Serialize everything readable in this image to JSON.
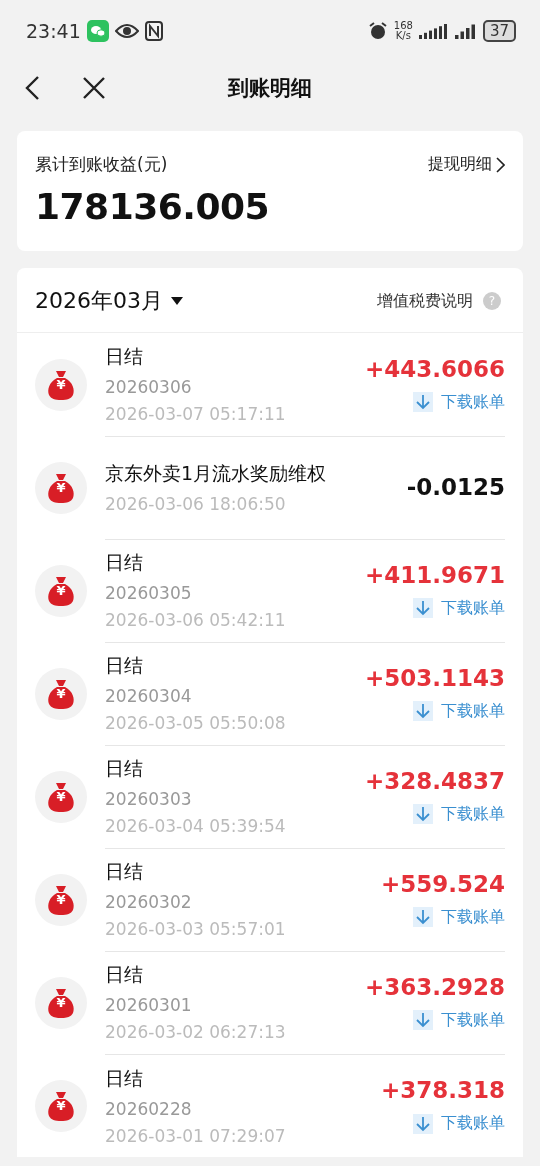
{
  "status_bar": {
    "time": "23:41",
    "speed_value": "168",
    "speed_unit": "K/s",
    "battery": "37"
  },
  "header": {
    "title": "到账明细"
  },
  "summary": {
    "label": "累计到账收益(元)",
    "link": "提现明细",
    "total": "178136.005"
  },
  "list": {
    "month": "2026年03月",
    "tax_note": "增值税费说明",
    "help_mark": "?"
  },
  "rows": [
    {
      "kind": "settlement",
      "symbol": "¥",
      "title": "日结",
      "subtitle": "20260306",
      "time": "2026-03-07 05:17:11",
      "amount": "+443.6066",
      "income": true,
      "download": "下载账单"
    },
    {
      "kind": "adjustment",
      "symbol": "¥",
      "title": "京东外卖1月流水奖励维权",
      "time": "2026-03-06 18:06:50",
      "amount": "-0.0125",
      "income": false
    },
    {
      "kind": "settlement",
      "symbol": "¥",
      "title": "日结",
      "subtitle": "20260305",
      "time": "2026-03-06 05:42:11",
      "amount": "+411.9671",
      "income": true,
      "download": "下载账单"
    },
    {
      "kind": "settlement",
      "symbol": "¥",
      "title": "日结",
      "subtitle": "20260304",
      "time": "2026-03-05 05:50:08",
      "amount": "+503.1143",
      "income": true,
      "download": "下载账单"
    },
    {
      "kind": "settlement",
      "symbol": "¥",
      "title": "日结",
      "subtitle": "20260303",
      "time": "2026-03-04 05:39:54",
      "amount": "+328.4837",
      "income": true,
      "download": "下载账单"
    },
    {
      "kind": "settlement",
      "symbol": "¥",
      "title": "日结",
      "subtitle": "20260302",
      "time": "2026-03-03 05:57:01",
      "amount": "+559.524",
      "income": true,
      "download": "下载账单"
    },
    {
      "kind": "settlement",
      "symbol": "¥",
      "title": "日结",
      "subtitle": "20260301",
      "time": "2026-03-02 06:27:13",
      "amount": "+363.2928",
      "income": true,
      "download": "下载账单"
    },
    {
      "kind": "settlement",
      "symbol": "¥",
      "title": "日结",
      "subtitle": "20260228",
      "time": "2026-03-01 07:29:07",
      "amount": "+378.318",
      "income": true,
      "download": "下载账单"
    }
  ]
}
